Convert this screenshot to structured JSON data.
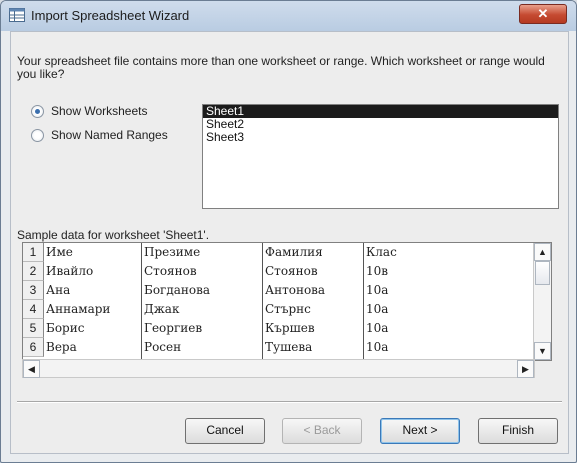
{
  "window": {
    "title": "Import Spreadsheet Wizard",
    "close_glyph": "✕"
  },
  "prompt": "Your spreadsheet file contains more than one worksheet or range. Which worksheet or range would you like?",
  "options": [
    {
      "label": "Show Worksheets",
      "checked": true
    },
    {
      "label": "Show Named Ranges",
      "checked": false
    }
  ],
  "sheets": [
    {
      "label": "Sheet1",
      "selected": true
    },
    {
      "label": "Sheet2",
      "selected": false
    },
    {
      "label": "Sheet3",
      "selected": false
    }
  ],
  "sample_label": "Sample data for worksheet 'Sheet1'.",
  "table": {
    "rows": [
      {
        "num": "1",
        "cells": [
          "Име",
          "Презиме",
          "Фамилия",
          "Клас"
        ]
      },
      {
        "num": "2",
        "cells": [
          "Ивайло",
          "Стоянов",
          "Стоянов",
          "10в"
        ]
      },
      {
        "num": "3",
        "cells": [
          "Ана",
          "Богданова",
          "Антонова",
          "10а"
        ]
      },
      {
        "num": "4",
        "cells": [
          "Аннамари",
          "Джак",
          "Стърнс",
          "10а"
        ]
      },
      {
        "num": "5",
        "cells": [
          "Борис",
          "Георгиев",
          "Кършев",
          "10а"
        ]
      },
      {
        "num": "6",
        "cells": [
          "Вера",
          "Росен",
          "Тушева",
          "10а"
        ]
      }
    ]
  },
  "buttons": {
    "cancel": "Cancel",
    "back": "< Back",
    "next": "Next >",
    "finish": "Finish"
  },
  "scroll": {
    "up": "▲",
    "down": "▼",
    "left": "◀",
    "right": "▶"
  },
  "colors": {
    "selection": "#1b1b1b",
    "close_button": "#c54a31",
    "default_button_border": "#3b79b8"
  }
}
